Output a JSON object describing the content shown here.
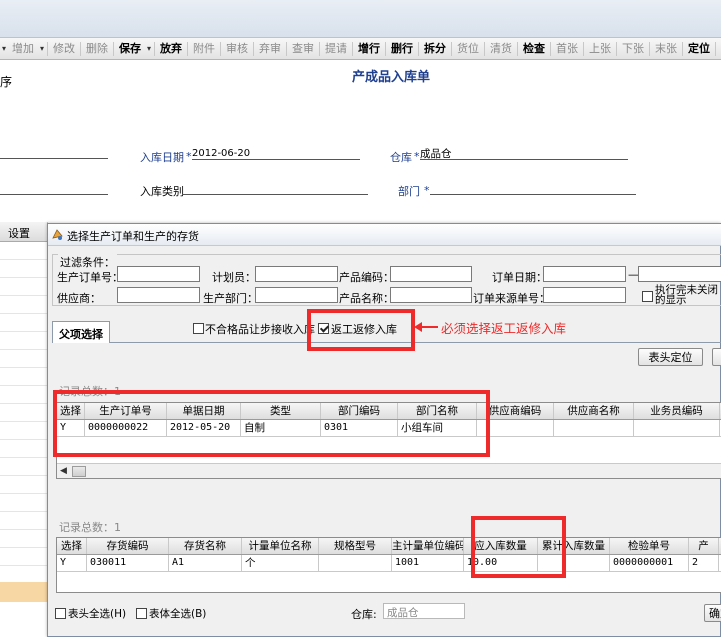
{
  "toolbar": {
    "items": [
      {
        "label": "增加",
        "enabled": false,
        "arrow": true
      },
      {
        "label": "修改",
        "enabled": false
      },
      {
        "label": "删除",
        "enabled": false
      },
      {
        "label": "保存",
        "enabled": true,
        "arrow": true
      },
      {
        "label": "放弃",
        "enabled": true
      },
      {
        "label": "附件",
        "enabled": false
      },
      {
        "label": "审核",
        "enabled": false
      },
      {
        "label": "弃审",
        "enabled": false
      },
      {
        "label": "查审",
        "enabled": false
      },
      {
        "label": "提请",
        "enabled": false
      },
      {
        "label": "增行",
        "enabled": true
      },
      {
        "label": "删行",
        "enabled": true
      },
      {
        "label": "拆分",
        "enabled": true
      },
      {
        "label": "货位",
        "enabled": false
      },
      {
        "label": "清货",
        "enabled": false
      },
      {
        "label": "检查",
        "enabled": true
      },
      {
        "label": "首张",
        "enabled": false
      },
      {
        "label": "上张",
        "enabled": false
      },
      {
        "label": "下张",
        "enabled": false
      },
      {
        "label": "末张",
        "enabled": false
      },
      {
        "label": "定位",
        "enabled": true
      }
    ]
  },
  "doc": {
    "left_fragment": "序",
    "title": "产成品入库单",
    "fields": {
      "date_label": "入库日期",
      "date_value": "2012-06-20",
      "warehouse_label": "仓库",
      "warehouse_value": "成品仓",
      "type_label": "入库类别",
      "dept_label": "部门",
      "required_mark": "*"
    }
  },
  "left_grid": {
    "header": "设置"
  },
  "dialog": {
    "title": "选择生产订单和生产的存货",
    "filter": {
      "group_label": "过滤条件：",
      "labels": {
        "order_no": "生产订单号：",
        "planner": "计划员：",
        "product_code": "产品编码：",
        "order_date": "订单日期：",
        "date_sep": "—",
        "supplier": "供应商：",
        "dept": "生产部门：",
        "product_name": "产品名称：",
        "source_no": "订单来源单号：",
        "show_done": "执行完未关闭的显示"
      }
    },
    "tab": {
      "label": "父项选择"
    },
    "checkboxes": {
      "unqualified": {
        "label": "不合格品让步接收入库",
        "checked": false
      },
      "rework": {
        "label": "返工返修入库",
        "checked": true
      }
    },
    "annotation": "必须选择返工返修入库",
    "buttons": {
      "locate_header": "表头定位",
      "confirm": "确定"
    },
    "upper_grid": {
      "record_count": "记录总数：1",
      "columns": [
        "选择",
        "生产订单号",
        "单据日期",
        "类型",
        "部门编码",
        "部门名称",
        "供应商编码",
        "供应商名称",
        "业务员编码"
      ],
      "rows": [
        [
          "Y",
          "0000000022",
          "2012-05-20",
          "自制",
          "0301",
          "小组车间",
          "",
          "",
          ""
        ]
      ]
    },
    "lower_grid": {
      "record_count": "记录总数：1",
      "columns": [
        "选择",
        "存货编码",
        "存货名称",
        "计量单位名称",
        "规格型号",
        "主计量单位编码",
        "应入库数量",
        "累计入库数量",
        "检验单号",
        "产"
      ],
      "rows": [
        [
          "Y",
          "030011",
          "A1",
          "个",
          "",
          "1001",
          "10.00",
          "",
          "0000000001",
          "2"
        ]
      ]
    },
    "bottom": {
      "select_all_header": "表头全选(H)",
      "select_all_body": "表体全选(B)",
      "warehouse_label": "仓库:",
      "warehouse_value": "成品仓"
    }
  },
  "colors": {
    "annotation_red": "#ee2a2a",
    "label_blue": "#1f3f8f"
  }
}
